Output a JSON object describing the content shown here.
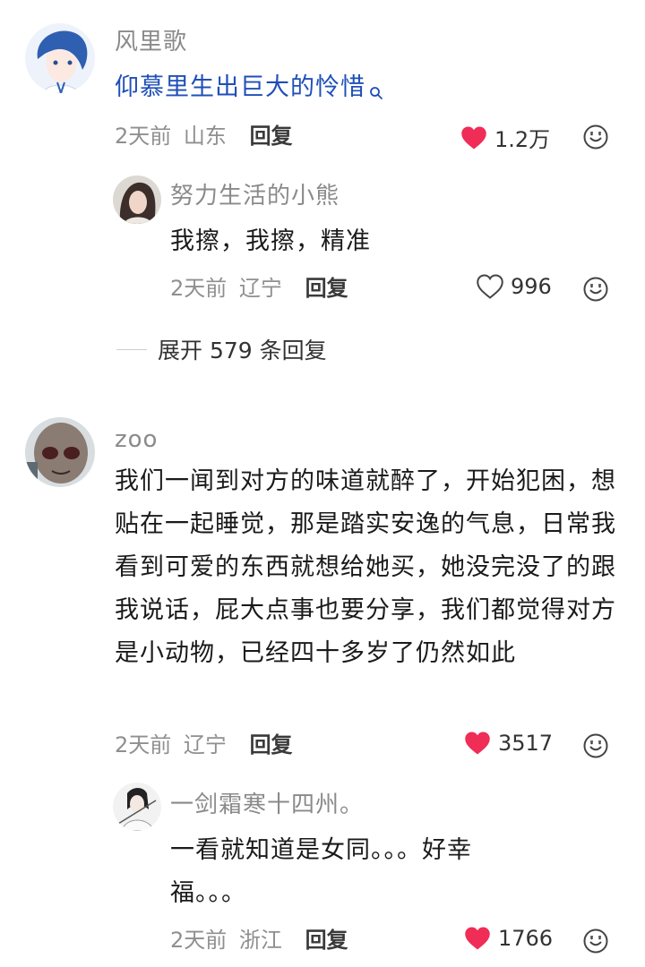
{
  "comments": [
    {
      "user": "风里歌",
      "text": "仰慕里生出巨大的怜惜",
      "time": "2天前",
      "location": "山东",
      "reply_label": "回复",
      "likes": "1.2万",
      "liked": true,
      "replies": [
        {
          "user": "努力生活的小熊",
          "text": "我擦，我擦，精准",
          "time": "2天前",
          "location": "辽宁",
          "reply_label": "回复",
          "likes": "996",
          "liked": false
        }
      ],
      "expand_label": "展开 579 条回复"
    },
    {
      "user": "zoo",
      "text": "我们一闻到对方的味道就醉了，开始犯困，想贴在一起睡觉，那是踏实安逸的气息，日常我看到可爱的东西就想给她买，她没完没了的跟我说话，屁大点事也要分享，我们都觉得对方是小动物，已经四十多岁了仍然如此",
      "time": "2天前",
      "location": "辽宁",
      "reply_label": "回复",
      "likes": "3517",
      "liked": true,
      "replies": [
        {
          "user": "一剑霜寒十四州。",
          "text": "一看就知道是女同。。。好幸福。。。",
          "time": "2天前",
          "location": "浙江",
          "reply_label": "回复",
          "likes": "1766",
          "liked": true
        }
      ]
    }
  ],
  "colors": {
    "like_active": "#ef2d56",
    "link": "#1f4fb8",
    "muted": "#8f8f8f"
  },
  "icons": [
    "heart-icon",
    "smile-icon",
    "search-icon"
  ]
}
